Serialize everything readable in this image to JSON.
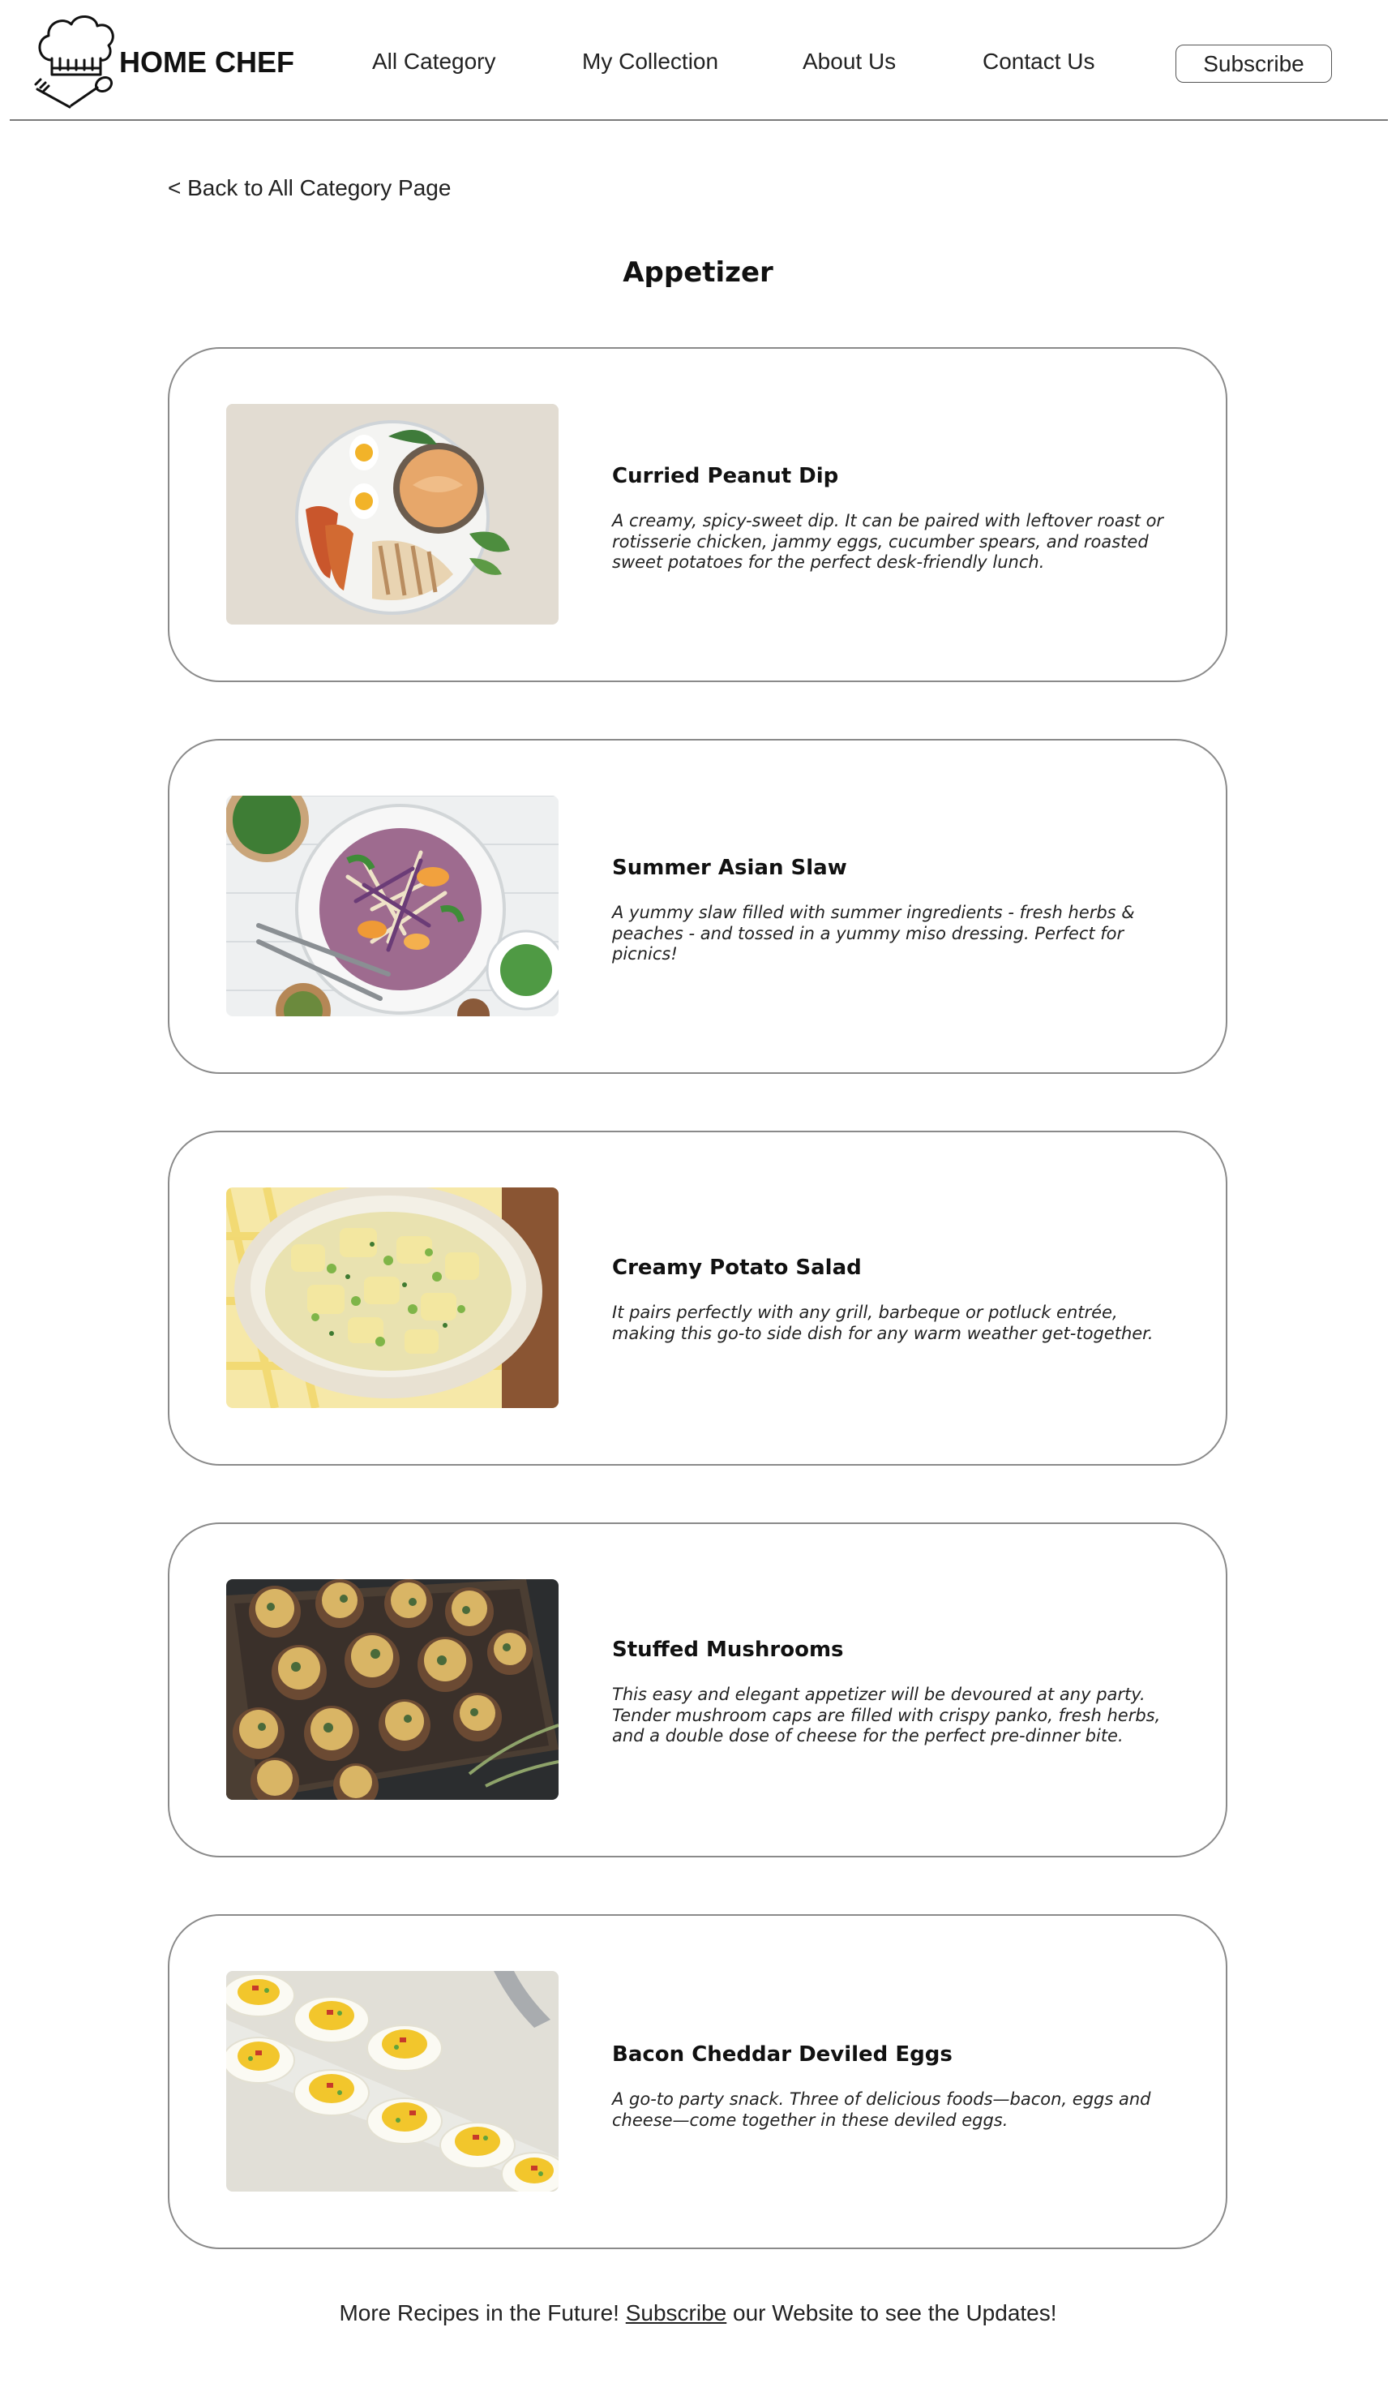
{
  "brand": {
    "name": "HOME CHEF",
    "logo_icon": "chef-hat-icon"
  },
  "nav": {
    "items": [
      {
        "label": "All Category"
      },
      {
        "label": "My Collection"
      },
      {
        "label": "About Us"
      },
      {
        "label": "Contact Us"
      }
    ],
    "subscribe_label": "Subscribe"
  },
  "back_link": "< Back to All Category Page",
  "page_title": "Appetizer",
  "recipes": [
    {
      "title": "Curried Peanut Dip",
      "description": "A creamy, spicy-sweet dip. It can be paired with leftover roast or rotisserie chicken, jammy eggs, cucumber spears, and roasted sweet potatoes for the perfect desk-friendly lunch.",
      "image": "curried-peanut-dip-photo"
    },
    {
      "title": "Summer Asian Slaw",
      "description": "A yummy slaw filled with summer ingredients - fresh herbs & peaches - and tossed in a yummy miso dressing. Perfect for picnics!",
      "image": "summer-asian-slaw-photo"
    },
    {
      "title": "Creamy Potato Salad",
      "description": "It pairs perfectly with any grill, barbeque or potluck entrée, making this go-to side dish for any warm weather get-together.",
      "image": "creamy-potato-salad-photo"
    },
    {
      "title": "Stuffed Mushrooms",
      "description": "This easy and elegant appetizer will be devoured at any party. Tender mushroom caps are filled with crispy panko, fresh herbs, and a double dose of cheese for the perfect pre-dinner bite.",
      "image": "stuffed-mushrooms-photo"
    },
    {
      "title": "Bacon Cheddar Deviled Eggs",
      "description": "A go-to party snack. Three of delicious foods—bacon, eggs and cheese—come together in these deviled eggs.",
      "image": "bacon-cheddar-deviled-eggs-photo"
    }
  ],
  "footer": {
    "before": "More Recipes in the Future! ",
    "link": "Subscribe",
    "after": " our Website to see the Updates!"
  }
}
